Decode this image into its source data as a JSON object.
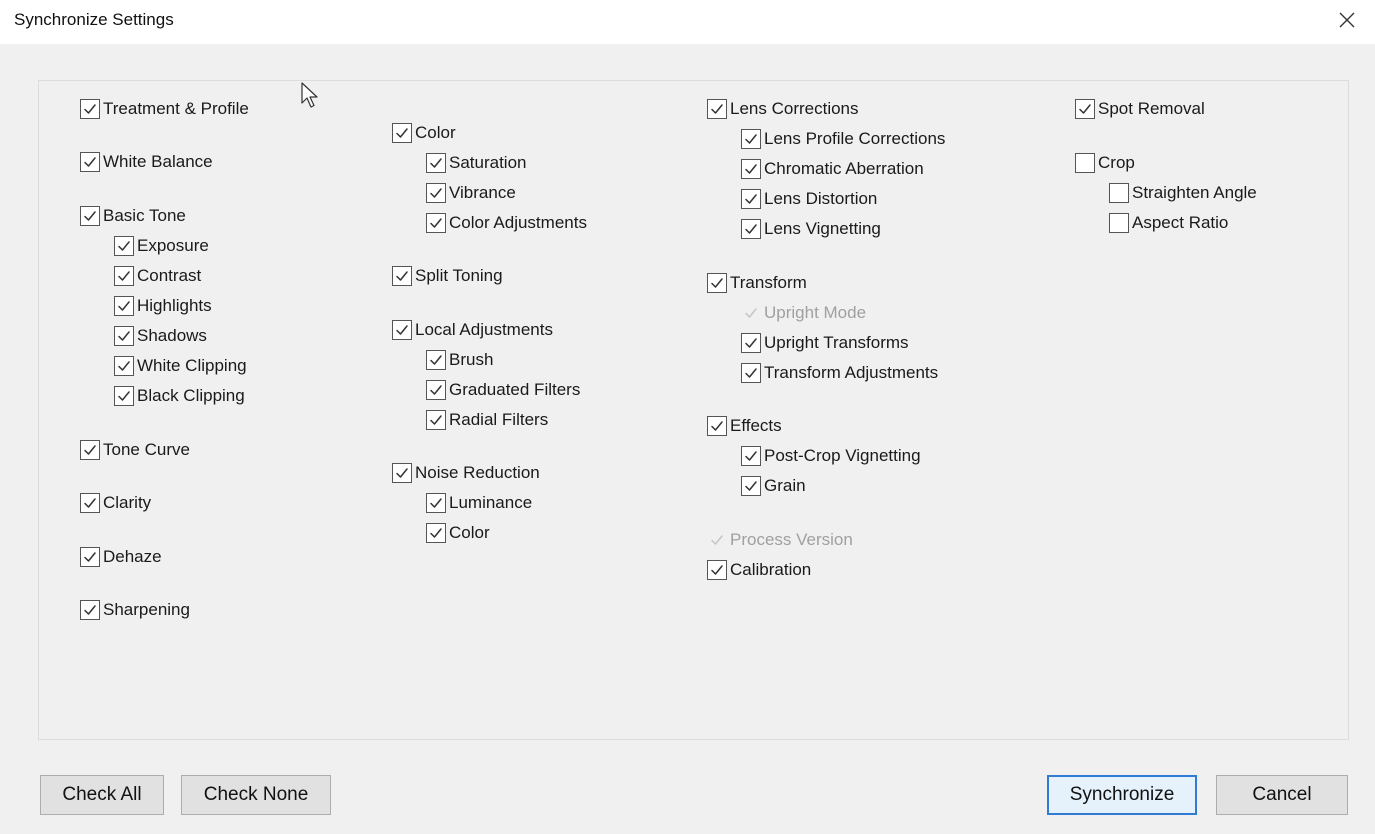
{
  "window": {
    "title": "Synchronize Settings"
  },
  "columns": [
    [
      {
        "label": "Treatment & Profile",
        "checked": true,
        "indent": 0,
        "disabled": false
      },
      {
        "label": "White Balance",
        "checked": true,
        "indent": 0,
        "disabled": false
      },
      {
        "label": "Basic Tone",
        "checked": true,
        "indent": 0,
        "disabled": false
      },
      {
        "label": "Exposure",
        "checked": true,
        "indent": 1,
        "disabled": false
      },
      {
        "label": "Contrast",
        "checked": true,
        "indent": 1,
        "disabled": false
      },
      {
        "label": "Highlights",
        "checked": true,
        "indent": 1,
        "disabled": false
      },
      {
        "label": "Shadows",
        "checked": true,
        "indent": 1,
        "disabled": false
      },
      {
        "label": "White Clipping",
        "checked": true,
        "indent": 1,
        "disabled": false
      },
      {
        "label": "Black Clipping",
        "checked": true,
        "indent": 1,
        "disabled": false
      },
      {
        "label": "Tone Curve",
        "checked": true,
        "indent": 0,
        "disabled": false
      },
      {
        "label": "Clarity",
        "checked": true,
        "indent": 0,
        "disabled": false
      },
      {
        "label": "Dehaze",
        "checked": true,
        "indent": 0,
        "disabled": false
      },
      {
        "label": "Sharpening",
        "checked": true,
        "indent": 0,
        "disabled": false
      }
    ],
    [
      {
        "label": "Color",
        "checked": true,
        "indent": 0,
        "disabled": false
      },
      {
        "label": "Saturation",
        "checked": true,
        "indent": 1,
        "disabled": false
      },
      {
        "label": "Vibrance",
        "checked": true,
        "indent": 1,
        "disabled": false
      },
      {
        "label": "Color Adjustments",
        "checked": true,
        "indent": 1,
        "disabled": false
      },
      {
        "label": "Split Toning",
        "checked": true,
        "indent": 0,
        "disabled": false
      },
      {
        "label": "Local Adjustments",
        "checked": true,
        "indent": 0,
        "disabled": false
      },
      {
        "label": "Brush",
        "checked": true,
        "indent": 1,
        "disabled": false
      },
      {
        "label": "Graduated Filters",
        "checked": true,
        "indent": 1,
        "disabled": false
      },
      {
        "label": "Radial Filters",
        "checked": true,
        "indent": 1,
        "disabled": false
      },
      {
        "label": "Noise Reduction",
        "checked": true,
        "indent": 0,
        "disabled": false
      },
      {
        "label": "Luminance",
        "checked": true,
        "indent": 1,
        "disabled": false
      },
      {
        "label": "Color",
        "checked": true,
        "indent": 1,
        "disabled": false
      }
    ],
    [
      {
        "label": "Lens Corrections",
        "checked": true,
        "indent": 0,
        "disabled": false
      },
      {
        "label": "Lens Profile Corrections",
        "checked": true,
        "indent": 1,
        "disabled": false
      },
      {
        "label": "Chromatic Aberration",
        "checked": true,
        "indent": 1,
        "disabled": false
      },
      {
        "label": "Lens Distortion",
        "checked": true,
        "indent": 1,
        "disabled": false
      },
      {
        "label": "Lens Vignetting",
        "checked": true,
        "indent": 1,
        "disabled": false
      },
      {
        "label": "Transform",
        "checked": true,
        "indent": 0,
        "disabled": false
      },
      {
        "label": "Upright Mode",
        "checked": true,
        "indent": 1,
        "disabled": true
      },
      {
        "label": "Upright Transforms",
        "checked": true,
        "indent": 1,
        "disabled": false
      },
      {
        "label": "Transform Adjustments",
        "checked": true,
        "indent": 1,
        "disabled": false
      },
      {
        "label": "Effects",
        "checked": true,
        "indent": 0,
        "disabled": false
      },
      {
        "label": "Post-Crop Vignetting",
        "checked": true,
        "indent": 1,
        "disabled": false
      },
      {
        "label": "Grain",
        "checked": true,
        "indent": 1,
        "disabled": false
      },
      {
        "label": "Process Version",
        "checked": true,
        "indent": 0,
        "disabled": true
      },
      {
        "label": "Calibration",
        "checked": true,
        "indent": 0,
        "disabled": false
      }
    ],
    [
      {
        "label": "Spot Removal",
        "checked": true,
        "indent": 0,
        "disabled": false
      },
      {
        "label": "Crop",
        "checked": false,
        "indent": 0,
        "disabled": false
      },
      {
        "label": "Straighten Angle",
        "checked": false,
        "indent": 1,
        "disabled": false
      },
      {
        "label": "Aspect Ratio",
        "checked": false,
        "indent": 1,
        "disabled": false
      }
    ]
  ],
  "buttons": {
    "check_all": "Check All",
    "check_none": "Check None",
    "synchronize": "Synchronize",
    "cancel": "Cancel"
  },
  "icons": {
    "close": "close-icon",
    "check": "check-icon",
    "cursor": "mouse-cursor-icon"
  },
  "colors": {
    "dialog_bg": "#f0f0f0",
    "primary_border": "#2f7bd5",
    "disabled_text": "#a0a0a0"
  }
}
